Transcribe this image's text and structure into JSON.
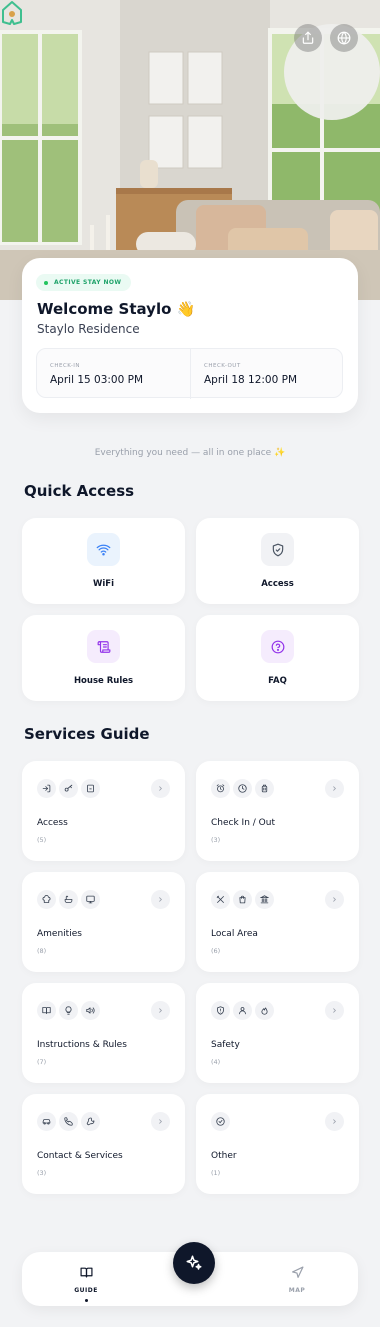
{
  "welcome": {
    "badge": "ACTIVE STAY NOW",
    "title": "Welcome Staylo 👋",
    "property": "Staylo Residence",
    "checkin_label": "CHECK-IN",
    "checkin_value": "April 15 03:00 PM",
    "checkout_label": "CHECK-OUT",
    "checkout_value": "April 18 12:00 PM"
  },
  "tagline": "Everything you need — all in one place ✨",
  "quick_access": {
    "title": "Quick Access",
    "items": [
      {
        "label": "WiFi",
        "icon": "wifi-icon",
        "color": "#3b82f6",
        "bg": "#eaf3fd"
      },
      {
        "label": "Access",
        "icon": "shield-icon",
        "color": "#4b5563",
        "bg": "#f1f2f5"
      },
      {
        "label": "House Rules",
        "icon": "scroll-icon",
        "color": "#9333ea",
        "bg": "#f5ecfd"
      },
      {
        "label": "FAQ",
        "icon": "help-circle-icon",
        "color": "#9333ea",
        "bg": "#f5ecfd"
      }
    ]
  },
  "services": {
    "title": "Services Guide",
    "items": [
      {
        "name": "Access",
        "count": "(5)",
        "icons": [
          "login-icon",
          "key-icon",
          "building-icon"
        ]
      },
      {
        "name": "Check In / Out",
        "count": "(3)",
        "icons": [
          "alarm-clock-icon",
          "clock-icon",
          "luggage-icon"
        ]
      },
      {
        "name": "Amenities",
        "count": "(8)",
        "icons": [
          "chef-hat-icon",
          "bath-icon",
          "monitor-icon"
        ]
      },
      {
        "name": "Local Area",
        "count": "(6)",
        "icons": [
          "utensils-icon",
          "shopping-bag-icon",
          "landmark-icon"
        ]
      },
      {
        "name": "Instructions & Rules",
        "count": "(7)",
        "icons": [
          "book-icon",
          "lightbulb-icon",
          "volume-icon"
        ]
      },
      {
        "name": "Safety",
        "count": "(4)",
        "icons": [
          "shield-alert-icon",
          "user-icon",
          "flame-icon"
        ]
      },
      {
        "name": "Contact & Services",
        "count": "(3)",
        "icons": [
          "car-icon",
          "phone-icon",
          "wrench-icon"
        ]
      },
      {
        "name": "Other",
        "count": "(1)",
        "icons": [
          "check-circle-icon"
        ]
      }
    ]
  },
  "nav": {
    "guide_label": "GUIDE",
    "map_label": "MAP",
    "active_color": "#0f172a",
    "inactive_color": "#9aa0ab"
  }
}
